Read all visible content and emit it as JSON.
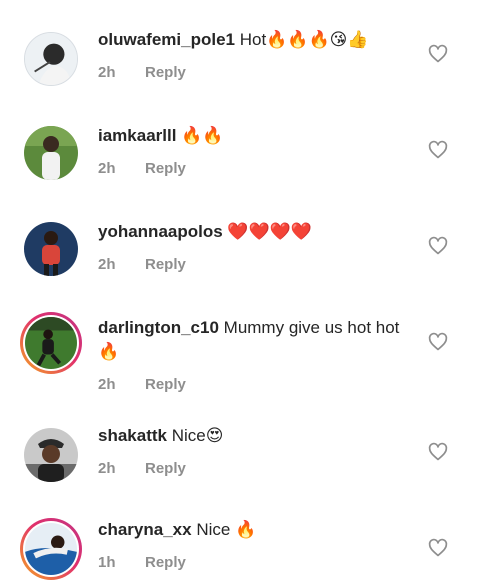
{
  "comments": [
    {
      "username": "oluwafemi_pole1",
      "text": "Hot🔥🔥🔥😘👍",
      "time": "2h",
      "reply": "Reply"
    },
    {
      "username": "iamkaarlll",
      "text": "🔥🔥",
      "time": "2h",
      "reply": "Reply"
    },
    {
      "username": "yohannaapolos",
      "text": "❤️❤️❤️❤️",
      "time": "2h",
      "reply": "Reply"
    },
    {
      "username": "darlington_c10",
      "text": "Mummy give us hot hot 🔥",
      "time": "2h",
      "reply": "Reply"
    },
    {
      "username": "shakattk",
      "text": "Nice😍",
      "time": "2h",
      "reply": "Reply"
    },
    {
      "username": "charyna_xx",
      "text": "Nice 🔥",
      "time": "1h",
      "reply": "Reply"
    }
  ],
  "icons": {
    "like": "heart-outline-icon"
  },
  "colors": {
    "text": "#262626",
    "secondary": "#8e8e8e",
    "story_ring_start": "#f5a623",
    "story_ring_end": "#c13584"
  }
}
